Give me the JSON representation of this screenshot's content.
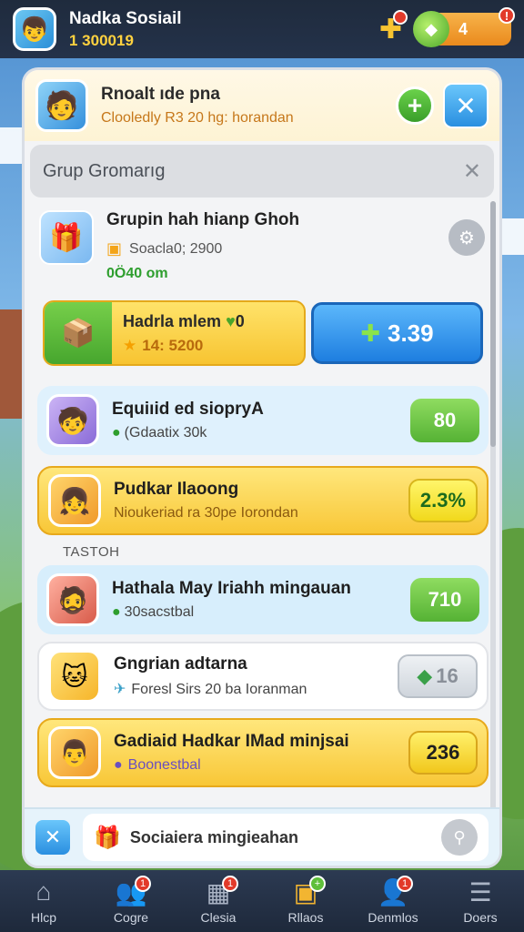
{
  "topbar": {
    "title": "Nadka Sosiail",
    "score": "1 300019",
    "gems": "4"
  },
  "panel_header": {
    "title": "Rnoalt ıde pna",
    "subtitle": "Clooledly R3 20 hg: horandan"
  },
  "group": {
    "title": "Grup Gromarıg"
  },
  "info": {
    "title": "Grupin hah hianp Ghoh",
    "line": "Soacla0; 2900",
    "green_text": "0Ö40 om"
  },
  "offer": {
    "title": "Hadrla mlem",
    "title_count": "0",
    "price": "14: 5200",
    "buy_label": "3.39"
  },
  "section_label": "TASTOH",
  "rows": [
    {
      "title": "Equiıid ed siopryA",
      "sub": "(Gdaatix 30k",
      "value": "80"
    },
    {
      "title": "Pudkar Ilaoong",
      "sub": "Nioukeriad ra 30pe Iorondan",
      "value": "2.3%"
    },
    {
      "title": "Hathala May Iriahh mingauan",
      "sub": "30sacstbal",
      "value": "710"
    },
    {
      "title": "Gngrian adtarna",
      "sub": "Foresl Sirs 20 ba Ioranman",
      "value": "16"
    },
    {
      "title": "Gadiaid Hadkar IMad minjsai",
      "sub": "Boonestbal",
      "value": "236"
    }
  ],
  "footer": {
    "text": "Sociaiera mingieahan"
  },
  "nav": [
    {
      "label": "Hlcp",
      "icon": "home-icon",
      "badge": ""
    },
    {
      "label": "Cogre",
      "icon": "people-icon",
      "badge": "1"
    },
    {
      "label": "Clesia",
      "icon": "calendar-icon",
      "badge": "1"
    },
    {
      "label": "Rllaos",
      "icon": "chest-icon",
      "badge": "+"
    },
    {
      "label": "Denmlos",
      "icon": "profile-icon",
      "badge": "1"
    },
    {
      "label": "Doers",
      "icon": "menu-icon",
      "badge": ""
    }
  ]
}
